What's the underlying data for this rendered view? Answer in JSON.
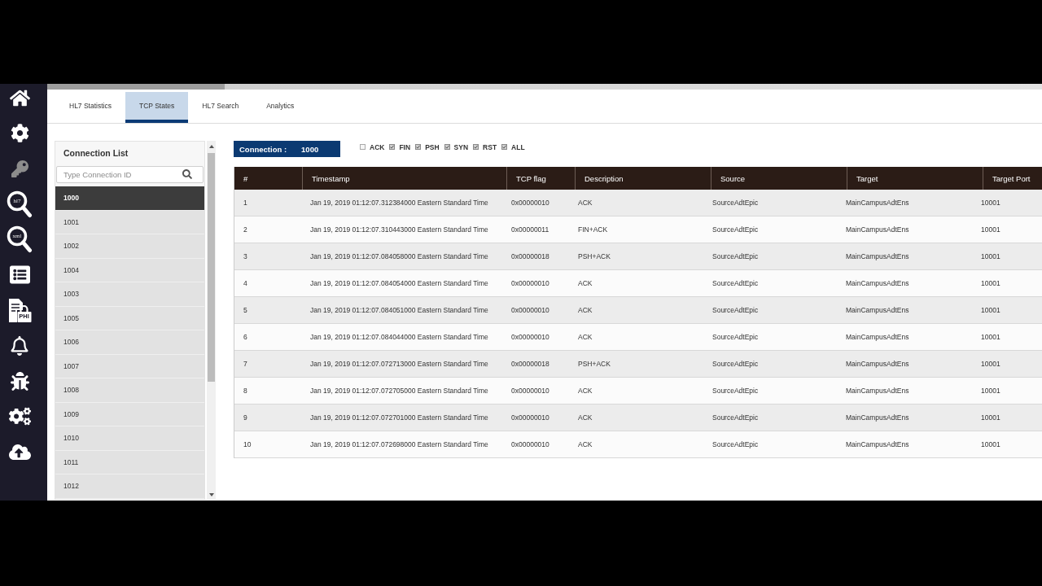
{
  "sidebar": {
    "items": [
      {
        "kind": "home",
        "disabled": false
      },
      {
        "kind": "settings",
        "disabled": false
      },
      {
        "kind": "key",
        "disabled": true
      },
      {
        "kind": "search",
        "label": "hl7",
        "disabled": false
      },
      {
        "kind": "search",
        "label": "xml",
        "disabled": false
      },
      {
        "kind": "list",
        "disabled": false
      },
      {
        "kind": "locked_document",
        "label": "PHI",
        "disabled": false
      },
      {
        "kind": "bell",
        "disabled": false
      },
      {
        "kind": "bug",
        "disabled": false
      },
      {
        "kind": "cogs",
        "disabled": false
      },
      {
        "kind": "upload",
        "disabled": false
      }
    ]
  },
  "tabs": [
    {
      "label": "HL7 Statistics",
      "selected": false
    },
    {
      "label": "TCP States",
      "selected": true
    },
    {
      "label": "HL7 Search",
      "selected": false
    },
    {
      "label": "Analytics",
      "selected": false
    }
  ],
  "connection_list": {
    "title": "Connection List",
    "search": {
      "placeholder": "Type Connection ID"
    },
    "items": [
      {
        "label": "1000",
        "selected": true
      },
      {
        "label": "1001",
        "selected": false
      },
      {
        "label": "1002",
        "selected": false
      },
      {
        "label": "1004",
        "selected": false
      },
      {
        "label": "1003",
        "selected": false
      },
      {
        "label": "1005",
        "selected": false
      },
      {
        "label": "1006",
        "selected": false
      },
      {
        "label": "1007",
        "selected": false
      },
      {
        "label": "1008",
        "selected": false
      },
      {
        "label": "1009",
        "selected": false
      },
      {
        "label": "1010",
        "selected": false
      },
      {
        "label": "1011",
        "selected": false
      },
      {
        "label": "1012",
        "selected": false
      }
    ]
  },
  "connection_badge": {
    "label": "Connection :",
    "value": "1000"
  },
  "filters": [
    {
      "label": "ACK",
      "checked": false
    },
    {
      "label": "FIN",
      "checked": true
    },
    {
      "label": "PSH",
      "checked": true
    },
    {
      "label": "SYN",
      "checked": true
    },
    {
      "label": "RST",
      "checked": true
    },
    {
      "label": "ALL",
      "checked": true
    }
  ],
  "table": {
    "columns": [
      "#",
      "Timestamp",
      "TCP flag",
      "Description",
      "Source",
      "Target",
      "Target Port"
    ],
    "rows": [
      [
        "1",
        "Jan 19, 2019 01:12:07.312384000 Eastern Standard Time",
        "0x00000010",
        "ACK",
        "SourceAdtEpic",
        "MainCampusAdtEns",
        "10001"
      ],
      [
        "2",
        "Jan 19, 2019 01:12:07.310443000 Eastern Standard Time",
        "0x00000011",
        "FIN+ACK",
        "SourceAdtEpic",
        "MainCampusAdtEns",
        "10001"
      ],
      [
        "3",
        "Jan 19, 2019 01:12:07.084058000 Eastern Standard Time",
        "0x00000018",
        "PSH+ACK",
        "SourceAdtEpic",
        "MainCampusAdtEns",
        "10001"
      ],
      [
        "4",
        "Jan 19, 2019 01:12:07.084054000 Eastern Standard Time",
        "0x00000010",
        "ACK",
        "SourceAdtEpic",
        "MainCampusAdtEns",
        "10001"
      ],
      [
        "5",
        "Jan 19, 2019 01:12:07.084051000 Eastern Standard Time",
        "0x00000010",
        "ACK",
        "SourceAdtEpic",
        "MainCampusAdtEns",
        "10001"
      ],
      [
        "6",
        "Jan 19, 2019 01:12:07.084044000 Eastern Standard Time",
        "0x00000010",
        "ACK",
        "SourceAdtEpic",
        "MainCampusAdtEns",
        "10001"
      ],
      [
        "7",
        "Jan 19, 2019 01:12:07.072713000 Eastern Standard Time",
        "0x00000018",
        "PSH+ACK",
        "SourceAdtEpic",
        "MainCampusAdtEns",
        "10001"
      ],
      [
        "8",
        "Jan 19, 2019 01:12:07.072705000 Eastern Standard Time",
        "0x00000010",
        "ACK",
        "SourceAdtEpic",
        "MainCampusAdtEns",
        "10001"
      ],
      [
        "9",
        "Jan 19, 2019 01:12:07.072701000 Eastern Standard Time",
        "0x00000010",
        "ACK",
        "SourceAdtEpic",
        "MainCampusAdtEns",
        "10001"
      ],
      [
        "10",
        "Jan 19, 2019 01:12:07.072698000 Eastern Standard Time",
        "0x00000010",
        "ACK",
        "SourceAdtEpic",
        "MainCampusAdtEns",
        "10001"
      ]
    ]
  }
}
